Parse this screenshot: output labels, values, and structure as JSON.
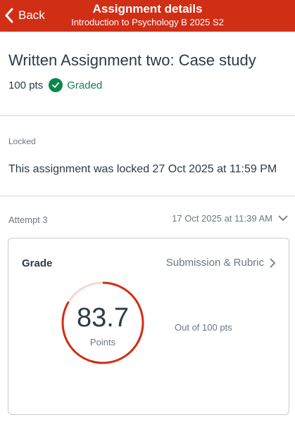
{
  "header": {
    "back_label": "Back",
    "title": "Assignment details",
    "subtitle": "Introduction to Psychology B 2025 S2",
    "bar_color": "#d12e16"
  },
  "assignment": {
    "title": "Written Assignment two: Case study",
    "points": "100 pts",
    "status": "Graded",
    "status_color": "#0b874b"
  },
  "lock": {
    "label": "Locked",
    "message": "This assignment was locked 27 Oct 2025 at 11:59 PM"
  },
  "attempt": {
    "label": "Attempt 3",
    "date": "17 Oct 2025 at 11:39 AM"
  },
  "grade": {
    "title": "Grade",
    "link_label": "Submission & Rubric",
    "score": "83.7",
    "score_unit": "Points",
    "out_of": "Out of 100 pts",
    "fraction": 0.837,
    "ring_color": "#d12e16",
    "ring_track_color": "#f4d8d2"
  }
}
